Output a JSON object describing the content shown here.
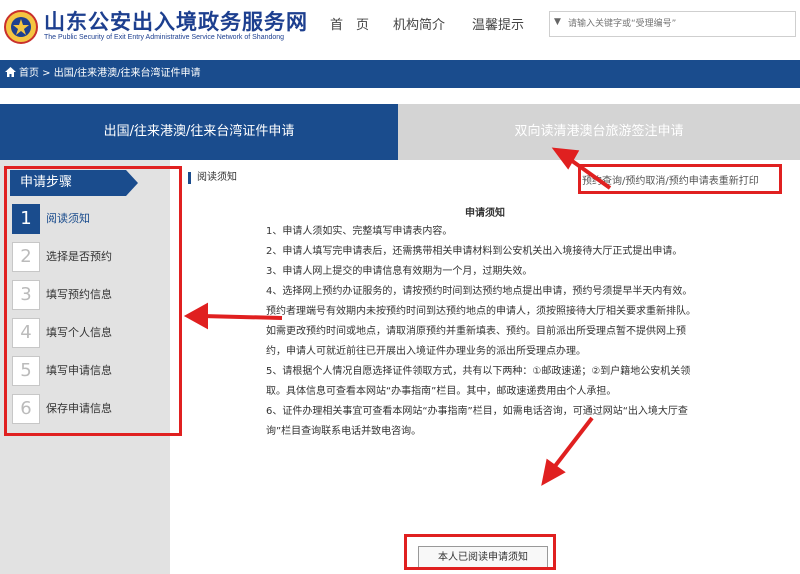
{
  "header": {
    "site_title": "山东公安出入境政务服务网",
    "site_subtitle": "The Public Security of Exit Entry Administrative Service Network of Shandong",
    "nav": [
      {
        "label": "首　页"
      },
      {
        "label": "机构简介"
      },
      {
        "label": "温馨提示"
      }
    ],
    "search_placeholder": "请输入关键字或“受理编号”"
  },
  "breadcrumb": "首页 > 出国/往来港澳/往来台湾证件申请",
  "tabs": [
    {
      "label": "出国/往来港澳/往来台湾证件申请",
      "active": true
    },
    {
      "label": "双向读清港澳台旅游签注申请",
      "active": false
    }
  ],
  "sidebar": {
    "header": "申请步骤",
    "steps": [
      {
        "num": "1",
        "label": "阅读须知",
        "active": true
      },
      {
        "num": "2",
        "label": "选择是否预约",
        "active": false
      },
      {
        "num": "3",
        "label": "填写预约信息",
        "active": false
      },
      {
        "num": "4",
        "label": "填写个人信息",
        "active": false
      },
      {
        "num": "5",
        "label": "填写申请信息",
        "active": false
      },
      {
        "num": "6",
        "label": "保存申请信息",
        "active": false
      }
    ]
  },
  "content": {
    "section_title": "阅读须知",
    "top_link": "预约查询/预约取消/预约申请表重新打印",
    "doc_title": "申请须知",
    "rules": [
      "1、申请人须如实、完整填写申请表内容。",
      "2、申请人填写完申请表后，还需携带相关申请材料到公安机关出入境接待大厅正式提出申请。",
      "3、申请人网上提交的申请信息有效期为一个月，过期失效。",
      "4、选择网上预约办证服务的，请按预约时间到达预约地点提出申请，预约号须提早半天内有效。预约者理端号有效期内未按预约时间到达预约地点的申请人，须按照接待大厅相关要求重新排队。如需更改预约时间或地点，请取消原预约并重新填表、预约。目前派出所受理点暂不提供网上预约，申请人可就近前往已开展出入境证件办理业务的派出所受理点办理。",
      "5、请根据个人情况自愿选择证件领取方式，共有以下两种：①邮政速递；②到户籍地公安机关领取。具体信息可查看本网站“办事指南”栏目。其中，邮政速递费用由个人承担。",
      "6、证件办理相关事宜可查看本网站“办事指南”栏目，如需电话咨询，可通过网站“出入境大厅查询”栏目查询联系电话并致电咨询。"
    ],
    "agree_button": "本人已阅读申请须知"
  },
  "colors": {
    "brand_blue": "#1a4c8d",
    "annotation_red": "#e02020",
    "sidebar_bg": "#e2e2e2",
    "tab_inactive_bg": "#d4d4d4"
  },
  "icons": [
    "police-emblem-icon",
    "home-icon",
    "chevron-down-icon"
  ]
}
